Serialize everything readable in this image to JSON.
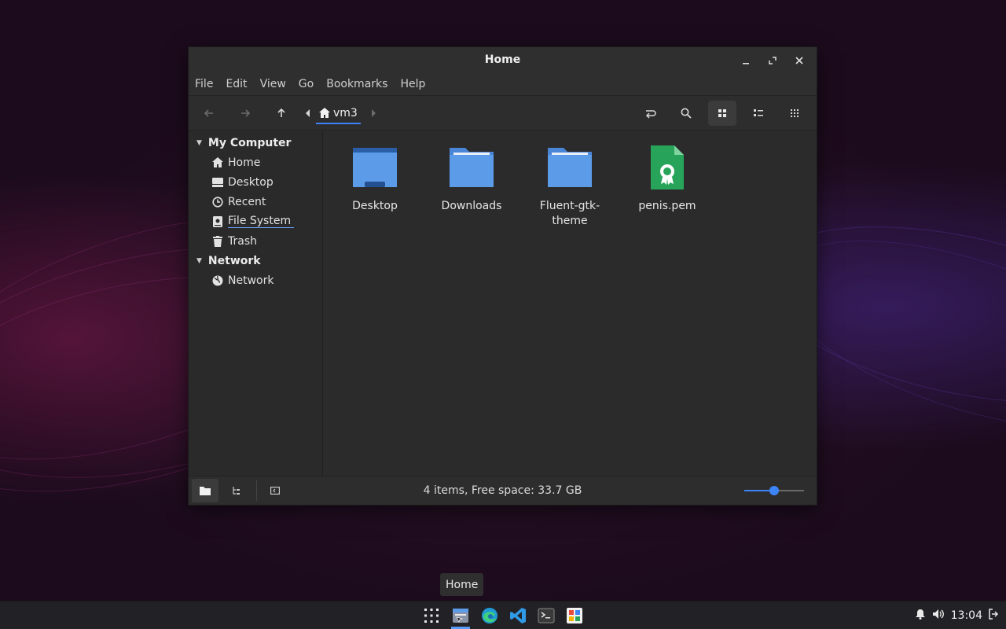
{
  "window": {
    "title": "Home",
    "controls": {
      "minimize": "–",
      "maximize": "⤢",
      "close": "✕"
    }
  },
  "menu": [
    "File",
    "Edit",
    "View",
    "Go",
    "Bookmarks",
    "Help"
  ],
  "toolbar": {
    "breadcrumb": "vm3",
    "buttons": [
      "back-icon",
      "forward-icon",
      "up-icon",
      "toggle-location-icon",
      "search-icon",
      "icon-view-icon",
      "list-view-icon",
      "compact-view-icon"
    ],
    "active_view": "icon-view"
  },
  "sidebar": {
    "groups": [
      {
        "label": "My Computer",
        "items": [
          {
            "label": "Home",
            "icon": "home-icon"
          },
          {
            "label": "Desktop",
            "icon": "desktop-icon"
          },
          {
            "label": "Recent",
            "icon": "recent-icon"
          },
          {
            "label": "File System",
            "icon": "drive-icon"
          },
          {
            "label": "Trash",
            "icon": "trash-icon"
          }
        ]
      },
      {
        "label": "Network",
        "items": [
          {
            "label": "Network",
            "icon": "network-icon"
          }
        ]
      }
    ]
  },
  "files": [
    {
      "name": "Desktop",
      "type": "folder-desktop"
    },
    {
      "name": "Downloads",
      "type": "folder"
    },
    {
      "name": "Fluent-gtk-theme",
      "name_lines": [
        "Fluent-gtk-",
        "theme"
      ],
      "type": "folder"
    },
    {
      "name": "penis.pem",
      "type": "certificate"
    }
  ],
  "status": {
    "text": "4 items, Free space: 33.7 GB",
    "zoom_level": 0.5
  },
  "tooltip": "Home",
  "taskbar": {
    "apps": [
      "app-grid-icon",
      "file-manager-icon",
      "edge-browser-icon",
      "vscode-icon",
      "terminal-icon",
      "app-store-icon"
    ],
    "clock": "13:04"
  },
  "colors": {
    "accent": "#3c84f7",
    "folder": "#5b9be8",
    "certificate": "#27a45a"
  }
}
